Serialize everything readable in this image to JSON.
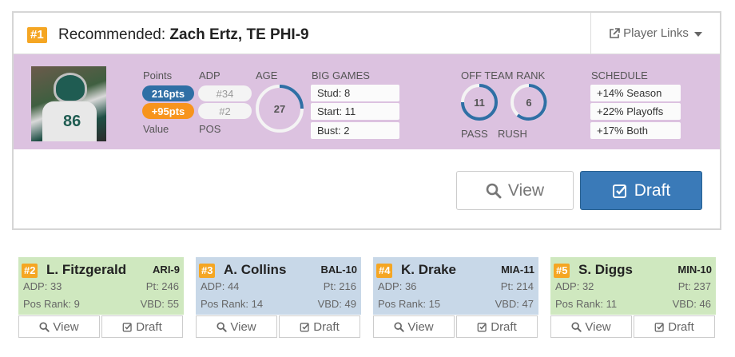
{
  "main": {
    "rank": "#1",
    "title_prefix": "Recommended:",
    "player_name": "Zach Ertz, TE PHI-9",
    "player_links_label": "Player Links",
    "photo_jersey_number": "86",
    "points_label": "Points",
    "points_value": "216pts",
    "value_value": "+95pts",
    "value_label": "Value",
    "adp_label": "ADP",
    "adp_value": "#34",
    "pos_value": "#2",
    "pos_label": "POS",
    "age_label": "AGE",
    "age_value": "27",
    "big_games_label": "BIG GAMES",
    "big_games": [
      "Stud: 8",
      "Start: 11",
      "Bust: 2"
    ],
    "off_team_rank_label": "OFF TEAM RANK",
    "pass_rank": "11",
    "rush_rank": "6",
    "pass_label": "PASS",
    "rush_label": "RUSH",
    "schedule_label": "SCHEDULE",
    "schedule": [
      "+14% Season",
      "+22% Playoffs",
      "+17% Both"
    ],
    "view_label": "View",
    "draft_label": "Draft"
  },
  "cards": [
    {
      "rank": "#2",
      "name": "L. Fitzgerald",
      "team": "ARI-9",
      "adp": "ADP: 33",
      "pt": "Pt: 246",
      "pos_rank": "Pos Rank: 9",
      "vbd": "VBD: 55",
      "view_label": "View",
      "draft_label": "Draft",
      "color": "#cfe8bf"
    },
    {
      "rank": "#3",
      "name": "A. Collins",
      "team": "BAL-10",
      "adp": "ADP: 44",
      "pt": "Pt: 216",
      "pos_rank": "Pos Rank: 14",
      "vbd": "VBD: 49",
      "view_label": "View",
      "draft_label": "Draft",
      "color": "#c8d8e8"
    },
    {
      "rank": "#4",
      "name": "K. Drake",
      "team": "MIA-11",
      "adp": "ADP: 36",
      "pt": "Pt: 214",
      "pos_rank": "Pos Rank: 15",
      "vbd": "VBD: 47",
      "view_label": "View",
      "draft_label": "Draft",
      "color": "#c8d8e8"
    },
    {
      "rank": "#5",
      "name": "S. Diggs",
      "team": "MIN-10",
      "adp": "ADP: 32",
      "pt": "Pt: 237",
      "pos_rank": "Pos Rank: 11",
      "vbd": "VBD: 46",
      "view_label": "View",
      "draft_label": "Draft",
      "color": "#cfe8bf"
    }
  ],
  "colors": {
    "rank_badge": "#f5a623",
    "points_pill": "#2f6fa5",
    "value_pill": "#f7941d",
    "stats_band": "#dcc2e0",
    "draft_button": "#3a7ab8",
    "ring_stroke": "#2f6fa5"
  },
  "icons": {
    "player_links": "external-link-icon",
    "view": "search-icon",
    "draft": "checkbox-icon",
    "dropdown": "caret-down-icon"
  }
}
